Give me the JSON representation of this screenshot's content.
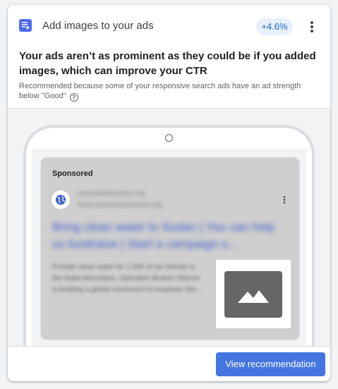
{
  "header": {
    "icon": "recommendation-image-icon",
    "title": "Add images to your ads",
    "uplift": "+4.6%",
    "menu_icon": "more-vert-icon"
  },
  "headline": "Your ads aren’t as prominent as they could be if you added images, which can improve your CTR",
  "reason": "Recommended because some of your responsive search ads have an ad strength below \"Good\"",
  "help_icon": "help-icon",
  "preview": {
    "sponsored_label": "Sponsored",
    "site_icon": "globe-icon",
    "blurred_url_1": "yourwebsitename.org",
    "blurred_url_2": "www.yourwebsitename.org",
    "blurred_headline": "Bring clean water to Sudan | You can help us fundraise | Start a campaign u...",
    "blurred_description": "Provide clean water for 1,000 of our friends in the Nuba Mountains. Operation Broken Silence is building a global movement to empower the...",
    "image_placeholder_icon": "image-icon"
  },
  "footer": {
    "button_label": "View recommendation"
  },
  "colors": {
    "accent": "#4575e0",
    "badge_bg": "#e8f0fe",
    "badge_text": "#1967d2"
  }
}
